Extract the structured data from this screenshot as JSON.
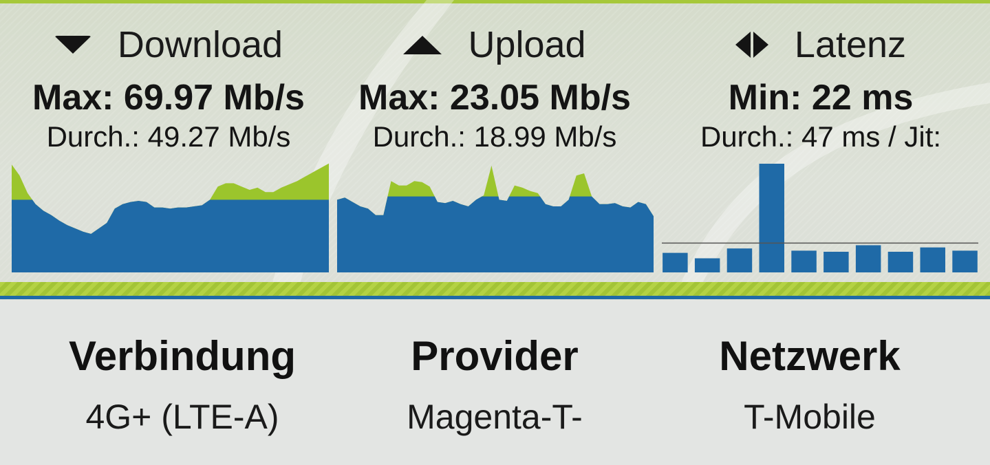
{
  "download": {
    "label": "Download",
    "max": "Max: 69.97 Mb/s",
    "avg": "Durch.: 49.27 Mb/s"
  },
  "upload": {
    "label": "Upload",
    "max": "Max: 23.05 Mb/s",
    "avg": "Durch.: 18.99 Mb/s"
  },
  "latency": {
    "label": "Latenz",
    "min": "Min: 22 ms",
    "avg": "Durch.: 47 ms / Jit:"
  },
  "info": {
    "connection": {
      "title": "Verbindung",
      "value": "4G+ (LTE-A)"
    },
    "provider": {
      "title": "Provider",
      "value": "Magenta-T-"
    },
    "network": {
      "title": "Netzwerk",
      "value": "T-Mobile"
    }
  },
  "colors": {
    "fill_blue": "#1f6aa7",
    "peak_green": "#9bc52c",
    "background": "#e3e5e3"
  },
  "icons": {
    "download": "triangle-down-icon",
    "upload": "triangle-up-icon",
    "latency": "left-right-arrows-icon"
  },
  "chart_data": [
    {
      "type": "area",
      "name": "download-speed-graph",
      "average_fraction": 0.66,
      "values": [
        0.98,
        0.88,
        0.72,
        0.62,
        0.56,
        0.52,
        0.47,
        0.43,
        0.4,
        0.37,
        0.35,
        0.4,
        0.45,
        0.58,
        0.62,
        0.64,
        0.65,
        0.64,
        0.59,
        0.59,
        0.58,
        0.59,
        0.59,
        0.6,
        0.61,
        0.66,
        0.78,
        0.81,
        0.81,
        0.78,
        0.75,
        0.77,
        0.73,
        0.73,
        0.77,
        0.8,
        0.83,
        0.87,
        0.91,
        0.95,
        0.99
      ]
    },
    {
      "type": "area",
      "name": "upload-speed-graph",
      "average_fraction": 0.69,
      "values": [
        0.66,
        0.68,
        0.64,
        0.6,
        0.58,
        0.52,
        0.52,
        0.83,
        0.79,
        0.79,
        0.83,
        0.82,
        0.78,
        0.64,
        0.63,
        0.65,
        0.62,
        0.6,
        0.66,
        0.7,
        0.97,
        0.66,
        0.65,
        0.79,
        0.77,
        0.74,
        0.72,
        0.62,
        0.6,
        0.6,
        0.66,
        0.88,
        0.9,
        0.69,
        0.62,
        0.62,
        0.63,
        0.6,
        0.59,
        0.64,
        0.62,
        0.51
      ]
    },
    {
      "type": "bar",
      "name": "latency-graph",
      "average_fraction": 0.27,
      "values": [
        0.18,
        0.13,
        0.22,
        1.0,
        0.2,
        0.19,
        0.25,
        0.19,
        0.23,
        0.2
      ]
    }
  ]
}
